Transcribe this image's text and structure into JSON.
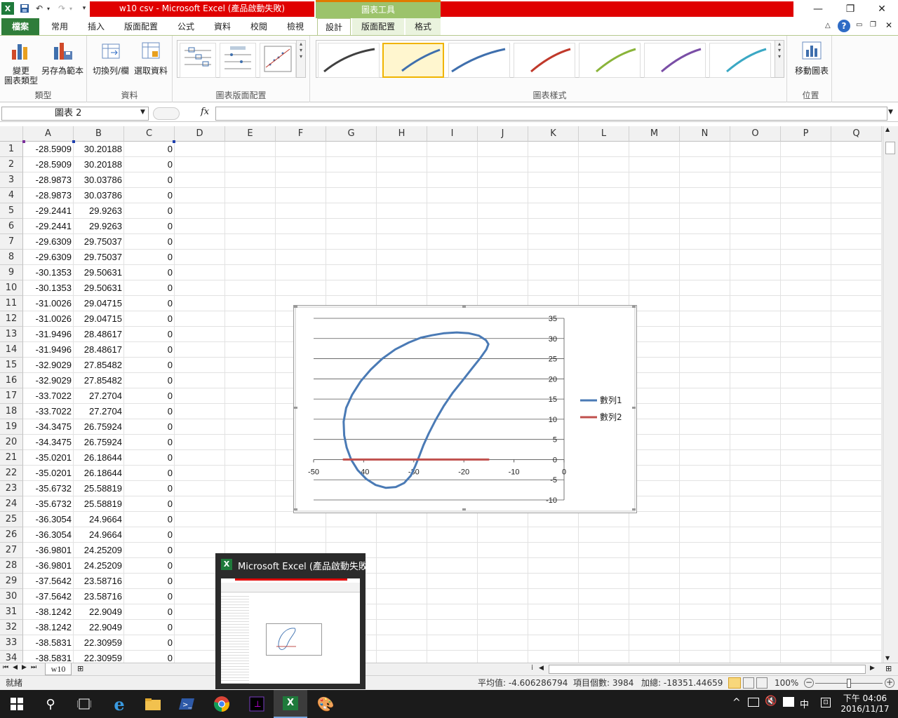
{
  "window": {
    "title": "w10 csv - Microsoft Excel (產品啟動失敗)",
    "context_title": "圖表工具"
  },
  "tabs": [
    "檔案",
    "常用",
    "插入",
    "版面配置",
    "公式",
    "資料",
    "校閱",
    "檢視",
    "設計",
    "版面配置",
    "格式"
  ],
  "ribbon": {
    "type_group": {
      "label": "類型",
      "change_type_line1": "變更",
      "change_type_line2": "圖表類型",
      "save_template": "另存為範本"
    },
    "data_group": {
      "label": "資料",
      "switch": "切換列/欄",
      "select": "選取資料"
    },
    "layout_group": {
      "label": "圖表版面配置"
    },
    "styles_group": {
      "label": "圖表樣式"
    },
    "location_group": {
      "label": "位置",
      "move": "移動圖表"
    },
    "style_colors": [
      "#404040",
      "#3f6fad",
      "#3f6fad",
      "#c0392b",
      "#8ab43a",
      "#7a4ea6",
      "#3ba8c4"
    ]
  },
  "formula": {
    "namebox": "圖表 2",
    "fx": "fx",
    "value": ""
  },
  "columns": [
    "A",
    "B",
    "C",
    "D",
    "E",
    "F",
    "G",
    "H",
    "I",
    "J",
    "K",
    "L",
    "M",
    "N",
    "O",
    "P",
    "Q"
  ],
  "rows": [
    {
      "n": "1",
      "a": "-28.5909",
      "b": "30.20188",
      "c": "0"
    },
    {
      "n": "2",
      "a": "-28.5909",
      "b": "30.20188",
      "c": "0"
    },
    {
      "n": "3",
      "a": "-28.9873",
      "b": "30.03786",
      "c": "0"
    },
    {
      "n": "4",
      "a": "-28.9873",
      "b": "30.03786",
      "c": "0"
    },
    {
      "n": "5",
      "a": "-29.2441",
      "b": "29.9263",
      "c": "0"
    },
    {
      "n": "6",
      "a": "-29.2441",
      "b": "29.9263",
      "c": "0"
    },
    {
      "n": "7",
      "a": "-29.6309",
      "b": "29.75037",
      "c": "0"
    },
    {
      "n": "8",
      "a": "-29.6309",
      "b": "29.75037",
      "c": "0"
    },
    {
      "n": "9",
      "a": "-30.1353",
      "b": "29.50631",
      "c": "0"
    },
    {
      "n": "10",
      "a": "-30.1353",
      "b": "29.50631",
      "c": "0"
    },
    {
      "n": "11",
      "a": "-31.0026",
      "b": "29.04715",
      "c": "0"
    },
    {
      "n": "12",
      "a": "-31.0026",
      "b": "29.04715",
      "c": "0"
    },
    {
      "n": "13",
      "a": "-31.9496",
      "b": "28.48617",
      "c": "0"
    },
    {
      "n": "14",
      "a": "-31.9496",
      "b": "28.48617",
      "c": "0"
    },
    {
      "n": "15",
      "a": "-32.9029",
      "b": "27.85482",
      "c": "0"
    },
    {
      "n": "16",
      "a": "-32.9029",
      "b": "27.85482",
      "c": "0"
    },
    {
      "n": "17",
      "a": "-33.7022",
      "b": "27.2704",
      "c": "0"
    },
    {
      "n": "18",
      "a": "-33.7022",
      "b": "27.2704",
      "c": "0"
    },
    {
      "n": "19",
      "a": "-34.3475",
      "b": "26.75924",
      "c": "0"
    },
    {
      "n": "20",
      "a": "-34.3475",
      "b": "26.75924",
      "c": "0"
    },
    {
      "n": "21",
      "a": "-35.0201",
      "b": "26.18644",
      "c": "0"
    },
    {
      "n": "22",
      "a": "-35.0201",
      "b": "26.18644",
      "c": "0"
    },
    {
      "n": "23",
      "a": "-35.6732",
      "b": "25.58819",
      "c": "0"
    },
    {
      "n": "24",
      "a": "-35.6732",
      "b": "25.58819",
      "c": "0"
    },
    {
      "n": "25",
      "a": "-36.3054",
      "b": "24.9664",
      "c": "0"
    },
    {
      "n": "26",
      "a": "-36.3054",
      "b": "24.9664",
      "c": "0"
    },
    {
      "n": "27",
      "a": "-36.9801",
      "b": "24.25209",
      "c": "0"
    },
    {
      "n": "28",
      "a": "-36.9801",
      "b": "24.25209",
      "c": "0"
    },
    {
      "n": "29",
      "a": "-37.5642",
      "b": "23.58716",
      "c": "0"
    },
    {
      "n": "30",
      "a": "-37.5642",
      "b": "23.58716",
      "c": "0"
    },
    {
      "n": "31",
      "a": "-38.1242",
      "b": "22.9049",
      "c": "0"
    },
    {
      "n": "32",
      "a": "-38.1242",
      "b": "22.9049",
      "c": "0"
    },
    {
      "n": "33",
      "a": "-38.5831",
      "b": "22.30959",
      "c": "0"
    },
    {
      "n": "34",
      "a": "-38.5831",
      "b": "22.30959",
      "c": "0"
    }
  ],
  "sheet": {
    "tab": "w10"
  },
  "status": {
    "ready": "就緒",
    "average": "平均值: -4.606286794",
    "count": "項目個數: 3984",
    "sum": "加總: -18351.44659",
    "zoom": "100%"
  },
  "preview": {
    "title": "Microsoft Excel (產品啟動失敗..."
  },
  "taskbar": {
    "time": "下午 04:06",
    "date": "2016/11/17",
    "ime": "中"
  },
  "chart_data": {
    "type": "scatter",
    "xlim": [
      -50,
      0
    ],
    "ylim": [
      -10,
      35
    ],
    "x_ticks": [
      "-50",
      "-40",
      "-30",
      "-20",
      "-10",
      "0"
    ],
    "y_ticks": [
      "35",
      "30",
      "25",
      "20",
      "15",
      "10",
      "5",
      "0",
      "-5",
      "-10"
    ],
    "grid": true,
    "legend_position": "right",
    "series": [
      {
        "name": "數列1",
        "color": "#4a7ab5",
        "x": [
          -28.6,
          -31.0,
          -33.7,
          -36.3,
          -38.6,
          -40.6,
          -42.3,
          -43.5,
          -44.0,
          -43.9,
          -43.4,
          -42.5,
          -41.2,
          -39.5,
          -37.6,
          -35.6,
          -33.6,
          -31.9,
          -30.6,
          -29.7,
          -28.9,
          -28.1,
          -27.0,
          -25.6,
          -24.0,
          -22.2,
          -20.2,
          -18.3,
          -16.7,
          -15.5,
          -15.1,
          -15.6,
          -17.0,
          -19.0,
          -21.4,
          -24.0,
          -26.4,
          -28.6
        ],
        "y": [
          30.2,
          29.0,
          27.3,
          25.0,
          22.3,
          19.4,
          16.1,
          12.8,
          9.4,
          6.0,
          3.0,
          0.0,
          -2.6,
          -4.8,
          -6.3,
          -7.0,
          -6.8,
          -5.8,
          -4.0,
          -1.6,
          0.9,
          3.5,
          6.5,
          9.9,
          13.3,
          16.6,
          19.7,
          22.7,
          25.2,
          27.3,
          28.6,
          29.6,
          30.7,
          31.3,
          31.5,
          31.3,
          30.8,
          30.2
        ]
      },
      {
        "name": "數列2",
        "color": "#c0504d",
        "x": [
          -44.0,
          -15.1
        ],
        "y": [
          0,
          0
        ]
      }
    ]
  }
}
